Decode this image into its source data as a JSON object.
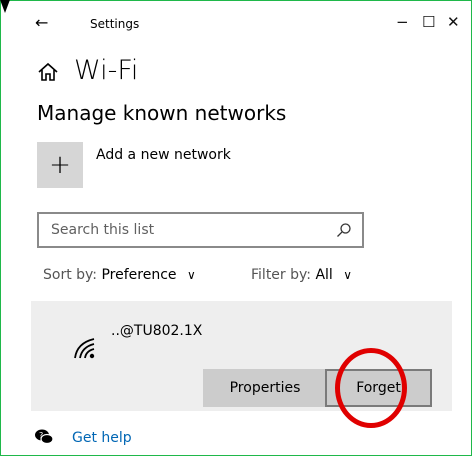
{
  "titlebar": {
    "back_glyph": "←",
    "title": "Settings",
    "minimize_glyph": "−",
    "maximize_glyph": "☐",
    "close_glyph": "✕"
  },
  "header": {
    "home_icon": "home-icon",
    "title": "Wi-Fi",
    "section": "Manage known networks"
  },
  "add_network": {
    "plus_glyph": "+",
    "label": "Add a new network"
  },
  "search": {
    "placeholder": "Search this list",
    "value": "",
    "icon": "search-icon"
  },
  "sort": {
    "label": "Sort by:",
    "value": "Preference"
  },
  "filter": {
    "label": "Filter by:",
    "value": "All"
  },
  "networks": [
    {
      "name": "..@TU802.1X",
      "icon": "wifi-icon",
      "properties_label": "Properties",
      "forget_label": "Forget"
    }
  ],
  "help": {
    "label": "Get help",
    "icon": "help-icon"
  },
  "colors": {
    "window_border": "#1fb84a",
    "annotation_circle": "#e00000",
    "link": "#0066b4"
  }
}
